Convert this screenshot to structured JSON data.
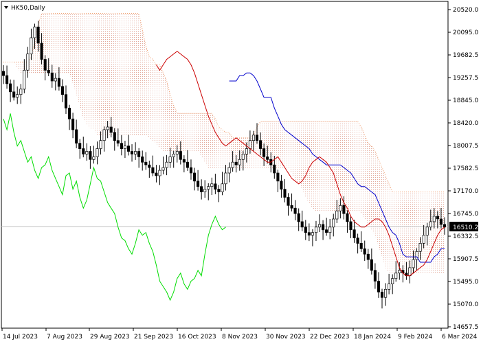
{
  "chart_data": {
    "type": "candlestick",
    "symbol_label": "HK50,Daily",
    "current_price": 16510.2,
    "current_price_label": "16510.2",
    "y_ticks": [
      "20520.0",
      "20095.0",
      "19682.5",
      "19257.5",
      "18845.0",
      "18420.0",
      "18007.5",
      "17582.5",
      "17170.0",
      "16745.0",
      "16332.5",
      "15907.5",
      "15495.0",
      "15070.0",
      "14657.5"
    ],
    "y_min": 14657.5,
    "y_max": 20520.0,
    "x_ticks": [
      "14 Jul 2023",
      "7 Aug 2023",
      "29 Aug 2023",
      "21 Sep 2023",
      "16 Oct 2023",
      "8 Nov 2023",
      "30 Nov 2023",
      "22 Dec 2023",
      "18 Jan 2024",
      "9 Feb 2024",
      "6 Mar 2024"
    ],
    "indicator": "Ichimoku Kinko Hyo",
    "series": [
      {
        "name": "",
        "role": "price",
        "values": [
          19300,
          19150,
          19000,
          18900,
          18950,
          19050,
          19400,
          19700,
          20000,
          20200,
          19900,
          19600,
          19400,
          19350,
          19200,
          19250,
          19100,
          18950,
          18700,
          18500,
          18300,
          18050,
          17950,
          17850,
          17900,
          17750,
          17800,
          17950,
          18100,
          18300,
          18350,
          18250,
          18100,
          18050,
          17950,
          18000,
          17900,
          17850,
          17900,
          17800,
          17700,
          17650,
          17600,
          17500,
          17450,
          17550,
          17600,
          17700,
          17800,
          17850,
          17900,
          17750,
          17700,
          17600,
          17500,
          17350,
          17250,
          17150,
          17200,
          17250,
          17300,
          17200,
          17150,
          17300,
          17500,
          17600,
          17700,
          17650,
          17750,
          17850,
          17950,
          18100,
          18200,
          18100,
          17950,
          17800,
          17750,
          17650,
          17500,
          17350,
          17200,
          17050,
          16900,
          16850,
          16750,
          16600,
          16500,
          16400,
          16350,
          16400,
          16500,
          16550,
          16450,
          16400,
          16500,
          16650,
          16800,
          16900,
          16750,
          16600,
          16450,
          16300,
          16200,
          16100,
          16000,
          15900,
          15700,
          15500,
          15300,
          15200,
          15350,
          15450,
          15550,
          15650,
          15700,
          15650,
          15600,
          15750,
          15900,
          16050,
          16200,
          16350,
          16500,
          16600,
          16700,
          16650,
          16550,
          16500
        ]
      },
      {
        "name": "",
        "role": "tenkan-sen",
        "color": "#cc0000",
        "values": [
          19500,
          19400,
          19500,
          19600,
          19650,
          19700,
          19750,
          19700,
          19650,
          19600,
          19500,
          19350,
          19150,
          18950,
          18750,
          18550,
          18400,
          18250,
          18150,
          18050,
          18000,
          18050,
          18100,
          18150,
          18100,
          18050,
          18000,
          17950,
          17900,
          17850,
          17800,
          17750,
          17700,
          17700,
          17750,
          17800,
          17700,
          17600,
          17500,
          17400,
          17350,
          17300,
          17350,
          17450,
          17600,
          17700,
          17750,
          17800,
          17750,
          17700,
          17600,
          17500,
          17300,
          17100,
          16950,
          16850,
          16700,
          16600,
          16550,
          16500,
          16500,
          16550,
          16600,
          16650,
          16650,
          16600,
          16500,
          16350,
          16150,
          15950,
          15750,
          15650,
          15600,
          15600,
          15650,
          15700,
          15750,
          15800,
          15900,
          16050,
          16200,
          16350,
          16450,
          16500
        ]
      },
      {
        "name": "",
        "role": "kijun-sen",
        "color": "#0000cc",
        "values": [
          19200,
          19200,
          19200,
          19300,
          19300,
          19350,
          19350,
          19300,
          19200,
          19050,
          18900,
          18900,
          18900,
          18700,
          18550,
          18400,
          18300,
          18250,
          18200,
          18150,
          18100,
          18050,
          18000,
          17950,
          17850,
          17800,
          17750,
          17700,
          17650,
          17650,
          17650,
          17650,
          17650,
          17600,
          17550,
          17500,
          17400,
          17300,
          17250,
          17250,
          17200,
          17150,
          17100,
          16950,
          16800,
          16650,
          16500,
          16400,
          16350,
          16200,
          16000,
          15950,
          15950,
          15950,
          15950,
          15850,
          15850,
          15850,
          15850,
          15950,
          16000,
          16100,
          16100
        ]
      },
      {
        "name": "",
        "role": "chikou-span",
        "color": "#00dd00",
        "values": [
          18500,
          18300,
          18600,
          18250,
          18000,
          18100,
          17900,
          17700,
          17800,
          17550,
          17400,
          17600,
          17650,
          17800,
          17550,
          17400,
          17250,
          17100,
          17450,
          17500,
          17200,
          17350,
          17050,
          16850,
          17000,
          17300,
          17600,
          17400,
          17350,
          17150,
          16950,
          16850,
          16750,
          16500,
          16300,
          16250,
          16100,
          16000,
          16200,
          16450,
          16350,
          16400,
          16200,
          16050,
          15800,
          15500,
          15400,
          15300,
          15150,
          15300,
          15550,
          15650,
          15450,
          15350,
          15500,
          15550,
          15700,
          15600,
          16000,
          16350,
          16550,
          16700,
          16550,
          16450,
          16500
        ]
      }
    ]
  }
}
